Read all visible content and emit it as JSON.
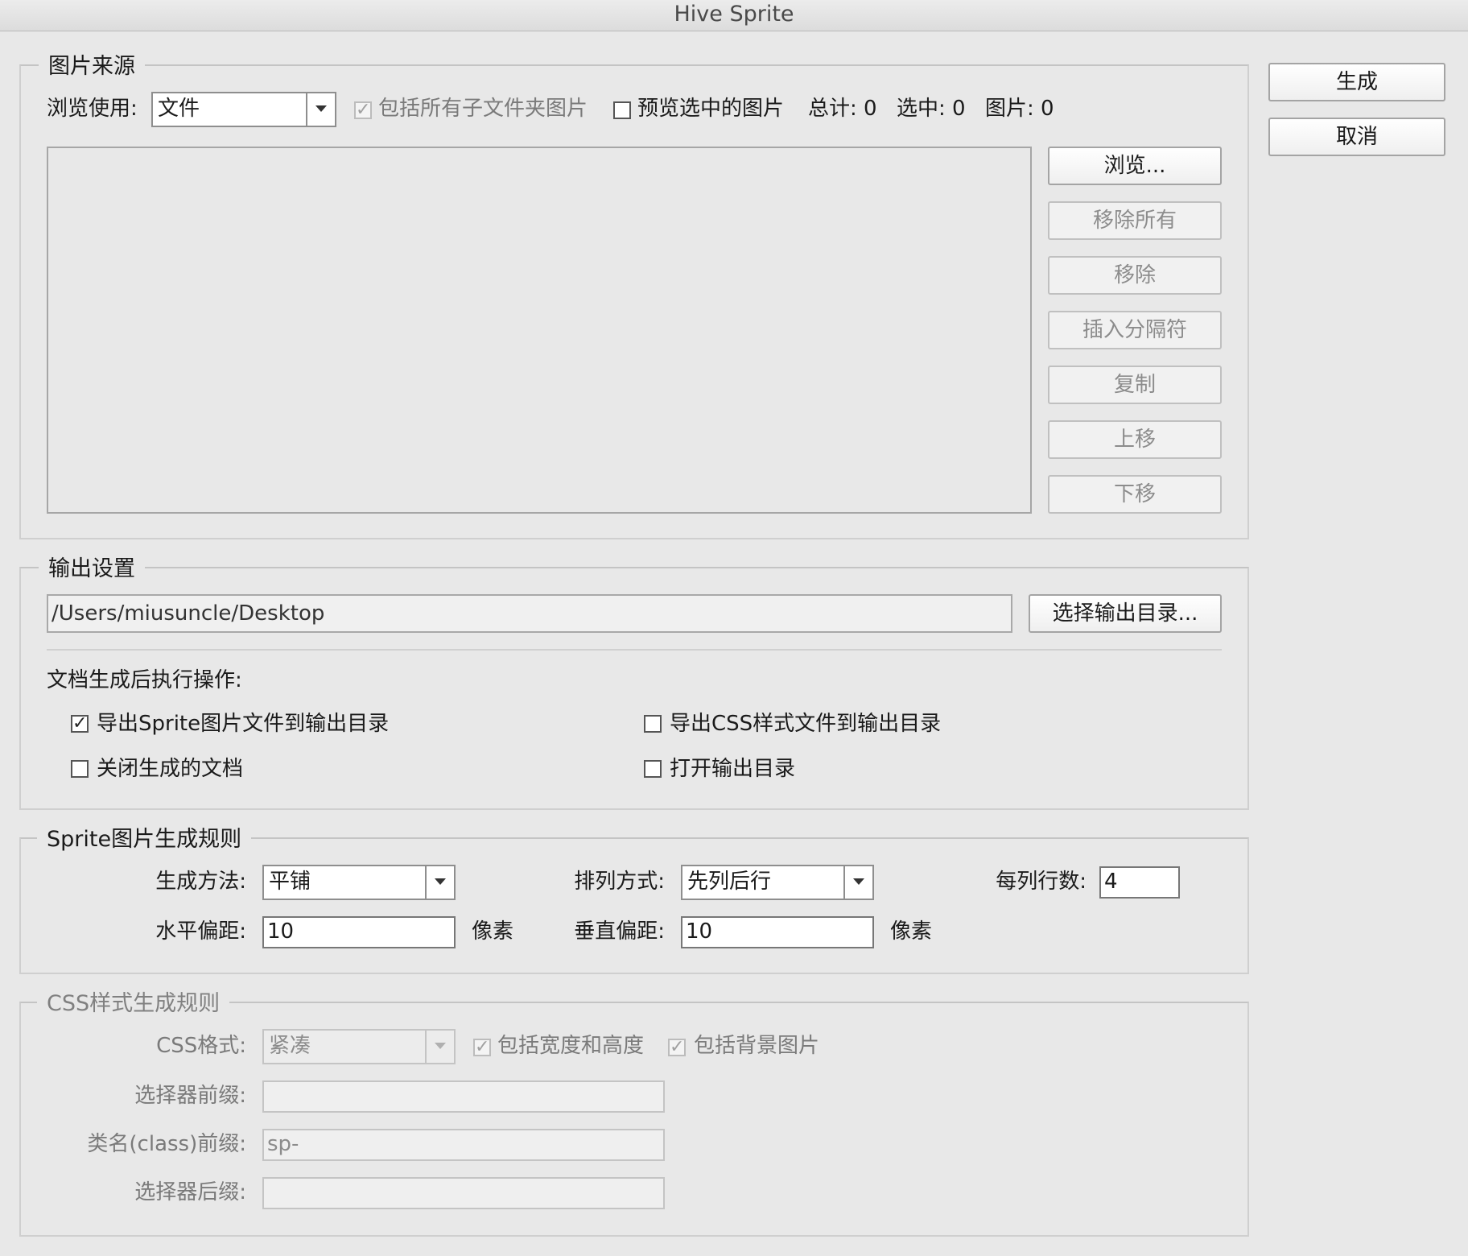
{
  "window": {
    "title": "Hive Sprite"
  },
  "main_actions": {
    "generate_label": "生成",
    "cancel_label": "取消"
  },
  "image_source": {
    "legend": "图片来源",
    "browse_using_label": "浏览使用:",
    "browse_using_value": "文件",
    "include_subfolders_label": "包括所有子文件夹图片",
    "preview_selected_label": "预览选中的图片",
    "total_label": "总计: 0",
    "selected_label": "选中: 0",
    "images_label": "图片: 0",
    "buttons": {
      "browse": "浏览...",
      "remove_all": "移除所有",
      "remove": "移除",
      "insert_separator": "插入分隔符",
      "duplicate": "复制",
      "move_up": "上移",
      "move_down": "下移"
    }
  },
  "output_settings": {
    "legend": "输出设置",
    "path_value": "/Users/miusuncle/Desktop",
    "choose_dir_label": "选择输出目录...",
    "after_generate_label": "文档生成后执行操作:",
    "export_sprite_label": "导出Sprite图片文件到输出目录",
    "export_css_label": "导出CSS样式文件到输出目录",
    "close_doc_label": "关闭生成的文档",
    "open_dir_label": "打开输出目录"
  },
  "sprite_rules": {
    "legend": "Sprite图片生成规则",
    "method_label": "生成方法:",
    "method_value": "平铺",
    "arrange_label": "排列方式:",
    "arrange_value": "先列后行",
    "rows_per_col_label": "每列行数:",
    "rows_per_col_value": "4",
    "h_offset_label": "水平偏距:",
    "h_offset_value": "10",
    "h_offset_unit": "像素",
    "v_offset_label": "垂直偏距:",
    "v_offset_value": "10",
    "v_offset_unit": "像素"
  },
  "css_rules": {
    "legend": "CSS样式生成规则",
    "format_label": "CSS格式:",
    "format_value": "紧凑",
    "include_size_label": "包括宽度和高度",
    "include_bg_label": "包括背景图片",
    "selector_prefix_label": "选择器前缀:",
    "selector_prefix_value": "",
    "class_prefix_label": "类名(class)前缀:",
    "class_prefix_value": "sp-",
    "selector_suffix_label": "选择器后缀:",
    "selector_suffix_value": ""
  }
}
